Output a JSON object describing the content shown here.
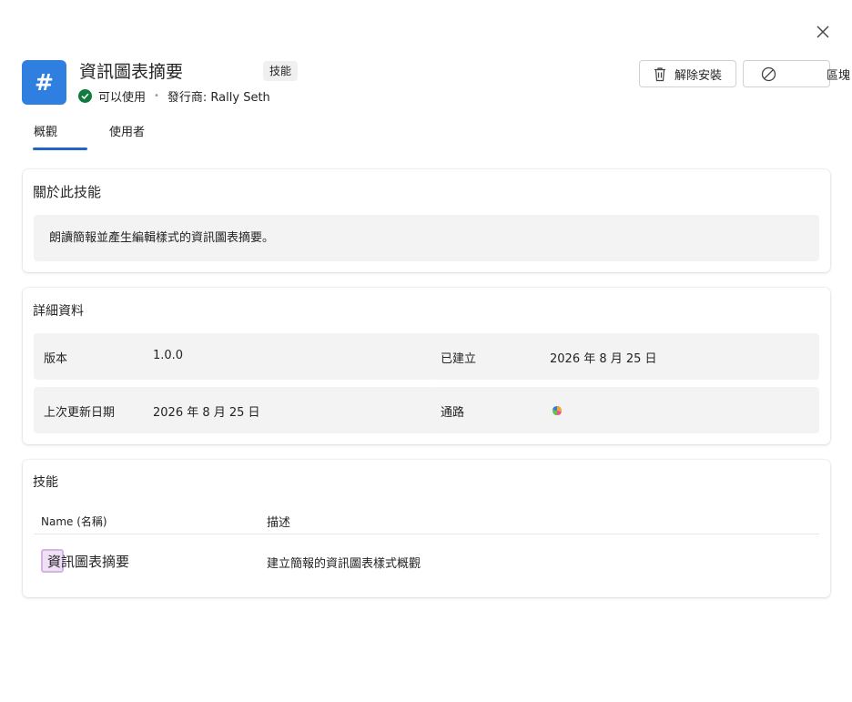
{
  "header": {
    "app_title": "資訊圖表摘要",
    "type_badge": "技能",
    "status_label": "可以使用",
    "publisher_label": "發行商: Rally Seth",
    "icon_glyph": "#",
    "icon_color": "#2f7fe0",
    "status_color": "#0f7b3f"
  },
  "actions": {
    "uninstall_label": "解除安裝",
    "block_label": "區塊"
  },
  "tabs": [
    {
      "label": "概觀",
      "active": true
    },
    {
      "label": "使用者",
      "active": false
    }
  ],
  "about": {
    "title": "關於此技能",
    "description": "朗讀簡報並產生編輯樣式的資訊圖表摘要。"
  },
  "details": {
    "title": "詳細資料",
    "version_label": "版本",
    "version_value": "1.0.0",
    "created_label": "已建立",
    "created_value": "2026 年 8 月 25 日",
    "updated_label": "上次更新日期",
    "updated_value": "2026 年 8 月 25 日",
    "channel_label": "通路",
    "channel_icon": "copilot-icon"
  },
  "skills": {
    "title": "技能",
    "columns": [
      "Name (名稱)",
      "描述"
    ],
    "rows": [
      {
        "name": "資訊圖表摘要",
        "description": "建立簡報的資訊圖表樣式概觀"
      }
    ]
  }
}
